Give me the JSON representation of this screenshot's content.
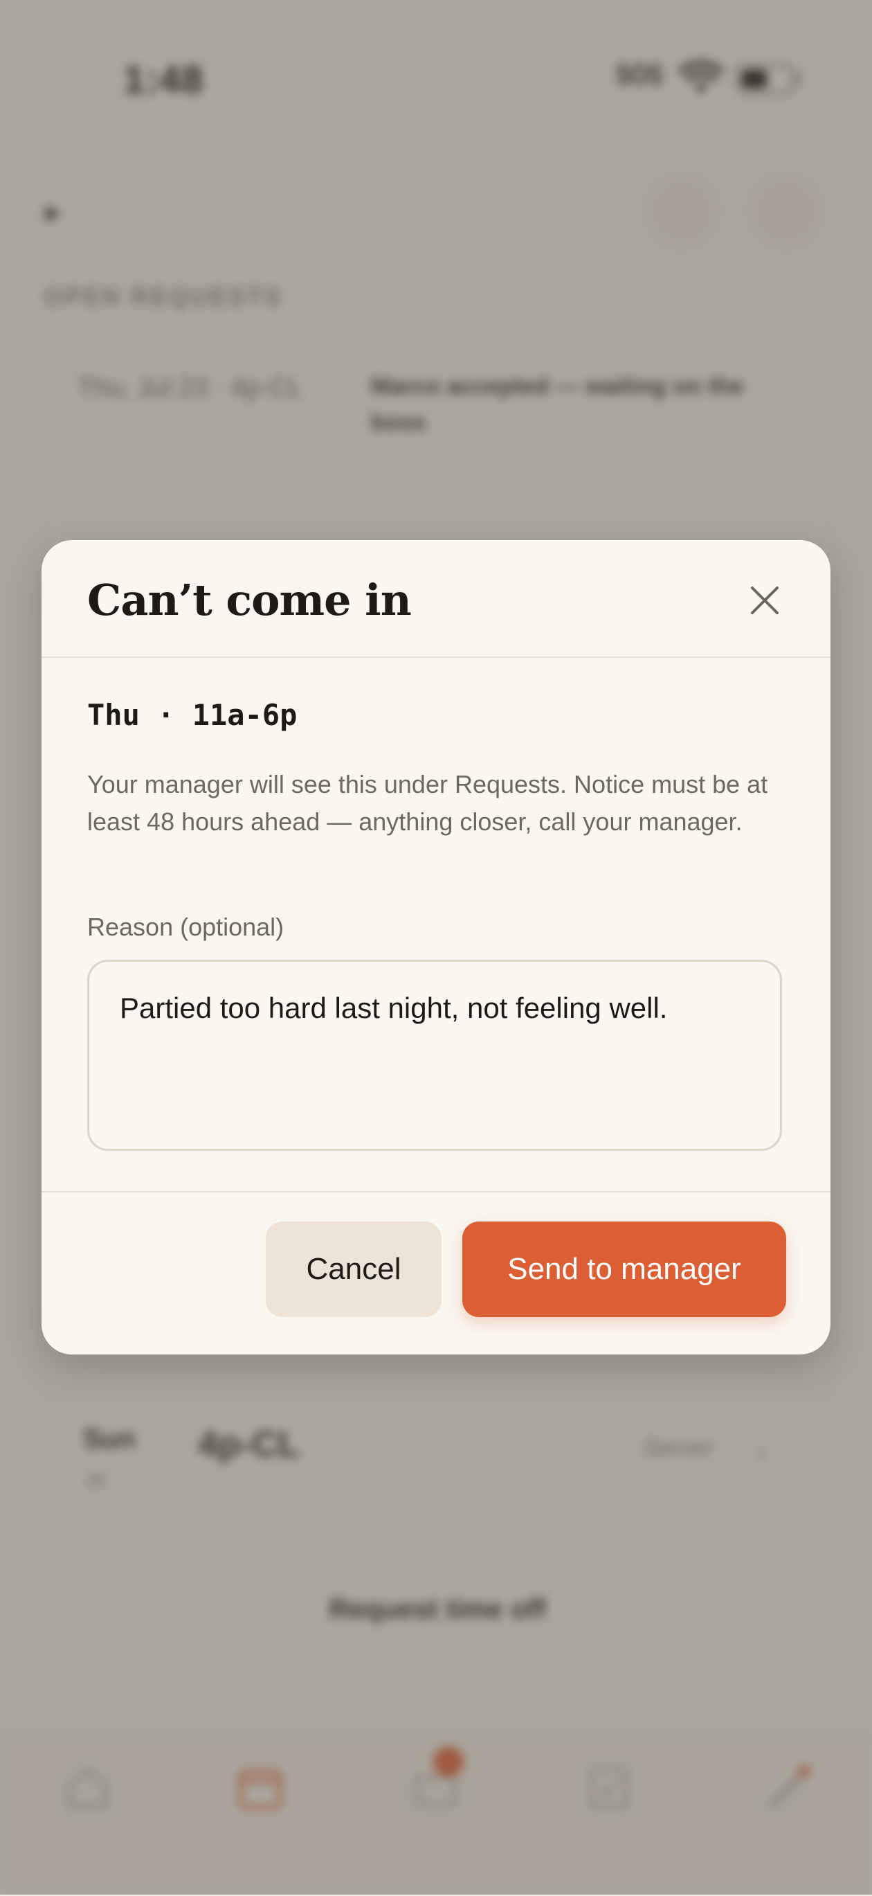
{
  "status_bar": {
    "time": "1:48",
    "sos": "SOS"
  },
  "background": {
    "section_label": "OPEN REQUESTS",
    "request_card": {
      "when": "Thu, Jul 23 · 4p-CL",
      "status": "Marco accepted — waiting on the boss"
    },
    "shift_card": {
      "day": "Sun",
      "date": "26",
      "time": "4p-CL",
      "role": "Server"
    },
    "timeoff_button": "Request time off"
  },
  "modal": {
    "title": "Can’t come in",
    "shift": "Thu · 11a-6p",
    "notice": "Your manager will see this under Requests. Notice must be at least 48 hours ahead — anything closer, call your manager.",
    "reason_label": "Reason (optional)",
    "reason_value": "Partied too hard last night, not feeling well.",
    "cancel_label": "Cancel",
    "send_label": "Send to manager"
  },
  "colors": {
    "accent": "#dc5e33",
    "modal_bg": "#faf6f0",
    "cancel_bg": "#ede4d7"
  }
}
